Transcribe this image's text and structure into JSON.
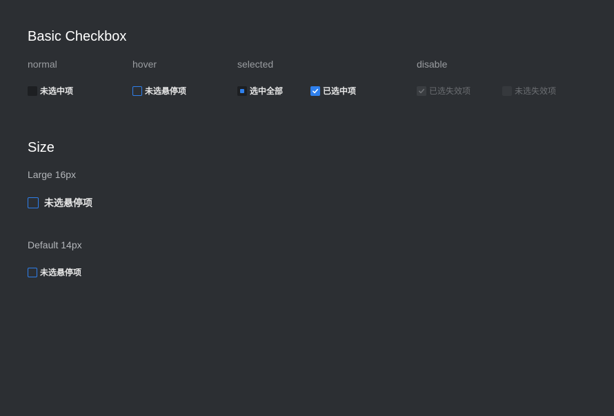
{
  "basic": {
    "title": "Basic Checkbox",
    "columns": {
      "normal": "normal",
      "hover": "hover",
      "selected": "selected",
      "disable": "disable"
    },
    "items": {
      "normal": "未选中项",
      "hover": "未选悬停项",
      "indeterminate": "选中全部",
      "checked": "已选中项",
      "disabled_checked": "已选失效项",
      "disabled_unchecked": "未选失效项"
    }
  },
  "size": {
    "title": "Size",
    "large_label": "Large 16px",
    "large_item": "未选悬停项",
    "default_label": "Default 14px",
    "default_item": "未选悬停项"
  },
  "colors": {
    "background": "#2c2f33",
    "accent": "#2f80ed",
    "box_empty": "#1d1f22"
  },
  "icons": {
    "checkmark": "check-icon"
  }
}
